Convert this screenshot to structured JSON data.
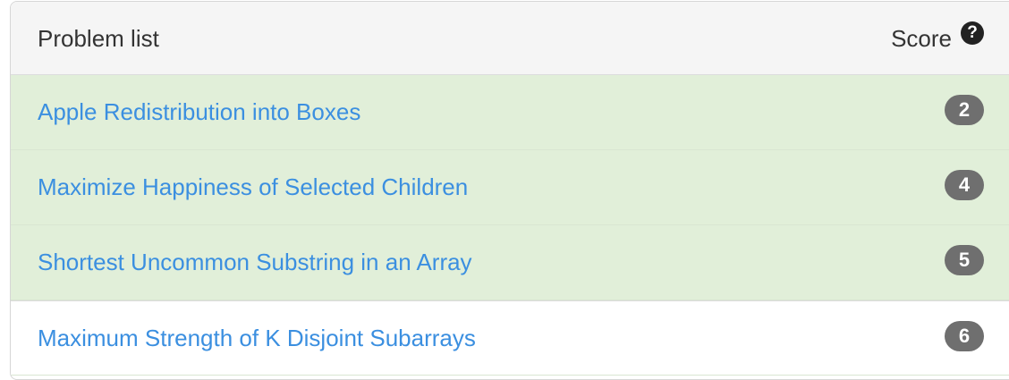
{
  "header": {
    "title": "Problem list",
    "score_label": "Score",
    "help_icon": "question-circle-icon",
    "help_glyph": "?"
  },
  "colors": {
    "solved_row": "#e1efd9",
    "link": "#3b8fe0",
    "badge": "#6f6f6f"
  },
  "problems": [
    {
      "title": "Apple Redistribution into Boxes",
      "score": "2",
      "status": "solved"
    },
    {
      "title": "Maximize Happiness of Selected Children",
      "score": "4",
      "status": "solved"
    },
    {
      "title": "Shortest Uncommon Substring in an Array",
      "score": "5",
      "status": "solved"
    },
    {
      "title": "Maximum Strength of K Disjoint Subarrays",
      "score": "6",
      "status": "unsolved"
    }
  ]
}
